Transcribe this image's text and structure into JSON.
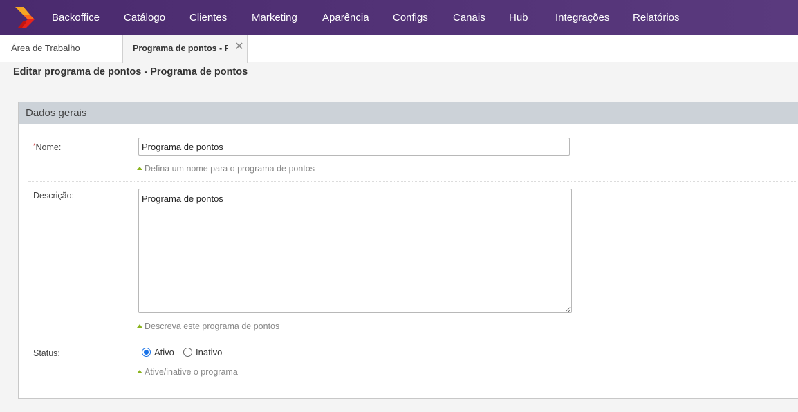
{
  "topnav": {
    "items": [
      "Backoffice",
      "Catálogo",
      "Clientes",
      "Marketing",
      "Aparência",
      "Configs",
      "Canais",
      "Hub",
      "Integrações",
      "Relatórios"
    ]
  },
  "tabs": {
    "home": "Área de Trabalho",
    "active": "Programa de pontos - Programa de pontos",
    "close_icon": "close-icon"
  },
  "page": {
    "title": "Editar programa de pontos - Programa de pontos"
  },
  "panel": {
    "title": "Dados gerais",
    "nome": {
      "required_mark": "*",
      "label": "Nome:",
      "value": "Programa de pontos",
      "hint": "Defina um nome para o programa de pontos"
    },
    "descricao": {
      "label": "Descrição:",
      "value": "Programa de pontos",
      "hint": "Descreva este programa de pontos"
    },
    "status": {
      "label": "Status:",
      "options": [
        "Ativo",
        "Inativo"
      ],
      "selected": "Ativo",
      "hint": "Ative/inative o programa"
    }
  },
  "colors": {
    "nav_bg": "#4a2a6e",
    "panel_header_bg": "#ccd2d8",
    "hint_icon": "#8ab31e",
    "radio_accent": "#1a73e8"
  }
}
